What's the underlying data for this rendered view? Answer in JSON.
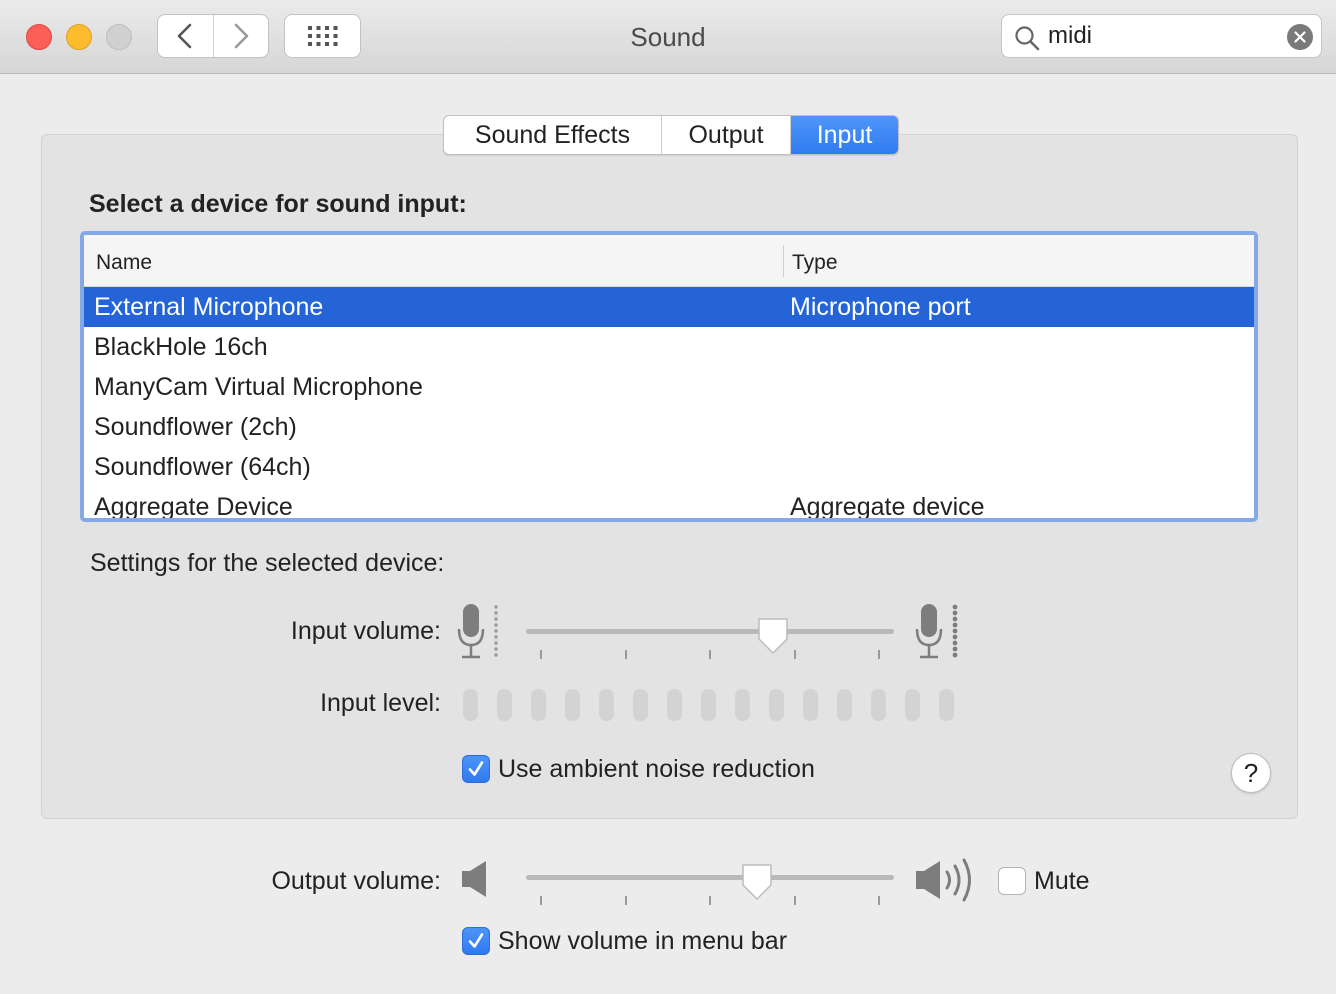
{
  "window": {
    "title": "Sound"
  },
  "search": {
    "value": "midi"
  },
  "tabs": [
    {
      "label": "Sound Effects",
      "active": false
    },
    {
      "label": "Output",
      "active": false
    },
    {
      "label": "Input",
      "active": true
    }
  ],
  "input_pane": {
    "title": "Select a device for sound input:",
    "columns": {
      "name": "Name",
      "type": "Type"
    },
    "devices": [
      {
        "name": "External Microphone",
        "type": "Microphone port",
        "selected": true
      },
      {
        "name": "BlackHole 16ch",
        "type": ""
      },
      {
        "name": "ManyCam Virtual Microphone",
        "type": ""
      },
      {
        "name": "Soundflower (2ch)",
        "type": ""
      },
      {
        "name": "Soundflower (64ch)",
        "type": ""
      },
      {
        "name": "Aggregate Device",
        "type": "Aggregate device"
      }
    ],
    "settings_title": "Settings for the selected device:",
    "input_volume_label": "Input volume:",
    "input_volume_value": 0.69,
    "input_level_label": "Input level:",
    "input_level_active_bars": 0,
    "noise_reduction_label": "Use ambient noise reduction",
    "noise_reduction_checked": true,
    "help_label": "?"
  },
  "output": {
    "volume_label": "Output volume:",
    "volume_value": 0.64,
    "mute_label": "Mute",
    "mute_checked": false,
    "show_in_menu_bar_label": "Show volume in menu bar",
    "show_in_menu_bar_checked": true
  },
  "colors": {
    "accent": "#2f7cf0",
    "selection": "#2464d6",
    "focus_ring": "#84a9e6"
  }
}
